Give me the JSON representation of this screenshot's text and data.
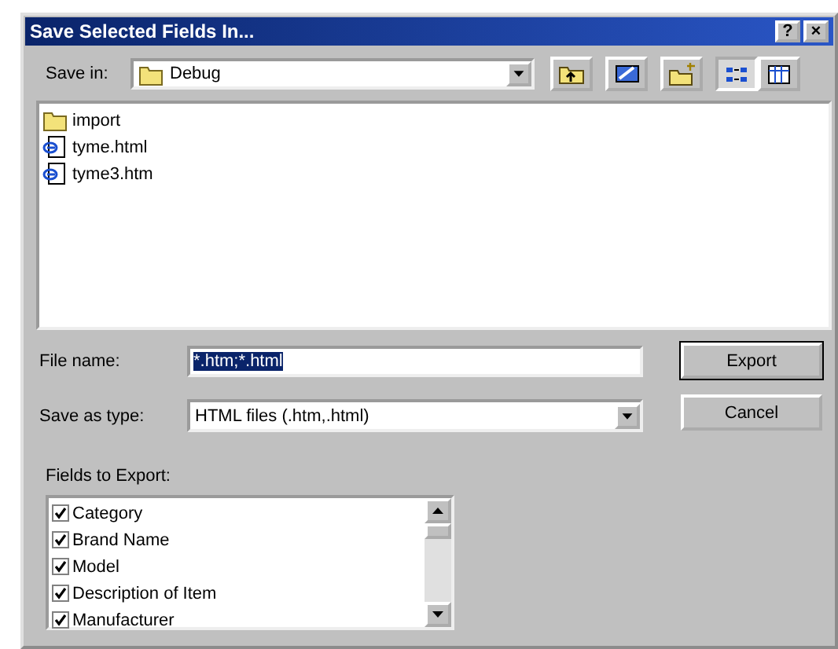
{
  "window": {
    "title": "Save Selected Fields In...",
    "help_button": "?",
    "close_button": "×"
  },
  "save_in": {
    "label": "Save in:",
    "value": "Debug"
  },
  "toolbar": [
    {
      "kind": "up"
    },
    {
      "kind": "desktop"
    },
    {
      "kind": "new-folder"
    }
  ],
  "view_buttons": [
    {
      "kind": "list",
      "selected": true
    },
    {
      "kind": "details",
      "selected": false
    }
  ],
  "files": [
    {
      "name": "import",
      "kind": "folder"
    },
    {
      "name": "tyme.html",
      "kind": "web"
    },
    {
      "name": "tyme3.htm",
      "kind": "web"
    }
  ],
  "file_name": {
    "label": "File name:",
    "value": "*.htm;*.html",
    "selected": true
  },
  "save_as_type": {
    "label": "Save as type:",
    "value": "HTML files (.htm,.html)"
  },
  "buttons": [
    {
      "label": "Export",
      "default": true
    },
    {
      "label": "Cancel",
      "default": false
    }
  ],
  "fields": {
    "label": "Fields to Export:",
    "items": [
      {
        "name": "Category",
        "checked": true
      },
      {
        "name": "Brand Name",
        "checked": true
      },
      {
        "name": "Model",
        "checked": true
      },
      {
        "name": "Description of Item",
        "checked": true
      },
      {
        "name": "Manufacturer",
        "checked": true
      }
    ]
  }
}
